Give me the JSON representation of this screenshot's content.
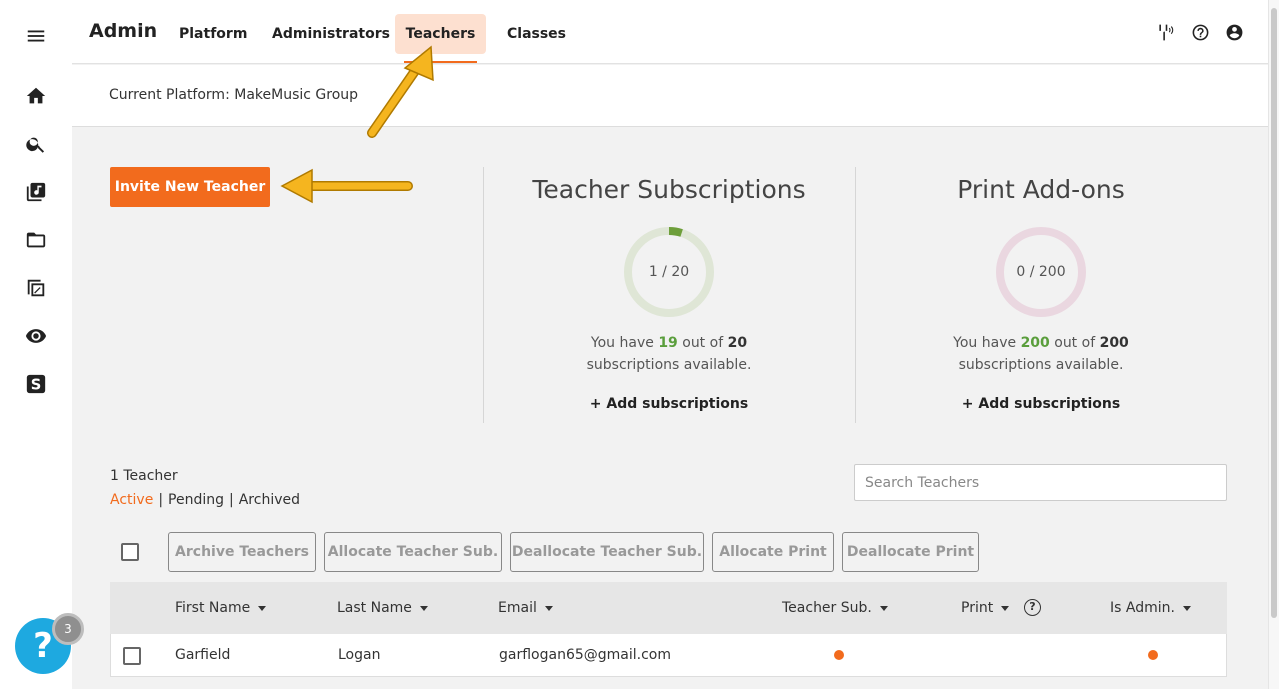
{
  "nav": {
    "brand": "Admin",
    "tabs": [
      {
        "label": "Platform"
      },
      {
        "label": "Administrators"
      },
      {
        "label": "Teachers",
        "active": true
      },
      {
        "label": "Classes"
      }
    ]
  },
  "rail_icons": [
    "menu-icon",
    "home-icon",
    "search-icon",
    "music-library-icon",
    "folder-icon",
    "score-icon",
    "eye-icon",
    "smartmusic-logo-icon"
  ],
  "top_icons": [
    "tuner-icon",
    "help-icon",
    "account-icon"
  ],
  "platform": {
    "text": "Current Platform: MakeMusic Group"
  },
  "invite_button": "Invite New Teacher",
  "teacher_subscriptions": {
    "title": "Teacher Subscriptions",
    "ring_label": "1 / 20",
    "used": 1,
    "total": 20,
    "text_prefix": "You have ",
    "available": "19",
    "text_mid": " out of ",
    "total_text": "20",
    "text_suffix": " subscriptions available.",
    "add": "+ Add subscriptions"
  },
  "print_addons": {
    "title": "Print Add-ons",
    "ring_label": "0 / 200",
    "used": 0,
    "total": 200,
    "text_prefix": "You have ",
    "available": "200",
    "text_mid": " out of ",
    "total_text": "200",
    "text_suffix": " subscriptions available.",
    "add": "+ Add subscriptions"
  },
  "list": {
    "count": "1 Teacher",
    "filters": [
      "Active",
      "Pending",
      "Archived"
    ],
    "search_placeholder": "Search Teachers"
  },
  "actions": [
    "Archive Teachers",
    "Allocate Teacher Sub.",
    "Deallocate Teacher Sub.",
    "Allocate Print",
    "Deallocate Print"
  ],
  "table": {
    "columns": [
      "First Name",
      "Last Name",
      "Email",
      "Teacher Sub.",
      "Print",
      "Is Admin."
    ],
    "rows": [
      {
        "first": "Garfield",
        "last": "Logan",
        "email": "garflogan65@gmail.com",
        "teacher_sub": true,
        "print": false,
        "is_admin": true
      }
    ]
  },
  "help": {
    "symbol": "?",
    "badge": "3"
  },
  "colors": {
    "accent": "#f26b1d",
    "green": "#5a9e3c",
    "help": "#1ea9e0"
  }
}
